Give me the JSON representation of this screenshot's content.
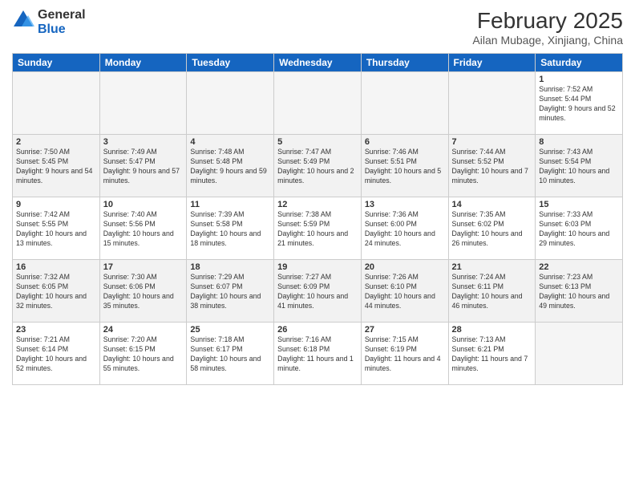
{
  "logo": {
    "line1": "General",
    "line2": "Blue"
  },
  "title": "February 2025",
  "subtitle": "Ailan Mubage, Xinjiang, China",
  "days_of_week": [
    "Sunday",
    "Monday",
    "Tuesday",
    "Wednesday",
    "Thursday",
    "Friday",
    "Saturday"
  ],
  "weeks": [
    [
      {
        "day": "",
        "info": ""
      },
      {
        "day": "",
        "info": ""
      },
      {
        "day": "",
        "info": ""
      },
      {
        "day": "",
        "info": ""
      },
      {
        "day": "",
        "info": ""
      },
      {
        "day": "",
        "info": ""
      },
      {
        "day": "1",
        "info": "Sunrise: 7:52 AM\nSunset: 5:44 PM\nDaylight: 9 hours and 52 minutes."
      }
    ],
    [
      {
        "day": "2",
        "info": "Sunrise: 7:50 AM\nSunset: 5:45 PM\nDaylight: 9 hours and 54 minutes."
      },
      {
        "day": "3",
        "info": "Sunrise: 7:49 AM\nSunset: 5:47 PM\nDaylight: 9 hours and 57 minutes."
      },
      {
        "day": "4",
        "info": "Sunrise: 7:48 AM\nSunset: 5:48 PM\nDaylight: 9 hours and 59 minutes."
      },
      {
        "day": "5",
        "info": "Sunrise: 7:47 AM\nSunset: 5:49 PM\nDaylight: 10 hours and 2 minutes."
      },
      {
        "day": "6",
        "info": "Sunrise: 7:46 AM\nSunset: 5:51 PM\nDaylight: 10 hours and 5 minutes."
      },
      {
        "day": "7",
        "info": "Sunrise: 7:44 AM\nSunset: 5:52 PM\nDaylight: 10 hours and 7 minutes."
      },
      {
        "day": "8",
        "info": "Sunrise: 7:43 AM\nSunset: 5:54 PM\nDaylight: 10 hours and 10 minutes."
      }
    ],
    [
      {
        "day": "9",
        "info": "Sunrise: 7:42 AM\nSunset: 5:55 PM\nDaylight: 10 hours and 13 minutes."
      },
      {
        "day": "10",
        "info": "Sunrise: 7:40 AM\nSunset: 5:56 PM\nDaylight: 10 hours and 15 minutes."
      },
      {
        "day": "11",
        "info": "Sunrise: 7:39 AM\nSunset: 5:58 PM\nDaylight: 10 hours and 18 minutes."
      },
      {
        "day": "12",
        "info": "Sunrise: 7:38 AM\nSunset: 5:59 PM\nDaylight: 10 hours and 21 minutes."
      },
      {
        "day": "13",
        "info": "Sunrise: 7:36 AM\nSunset: 6:00 PM\nDaylight: 10 hours and 24 minutes."
      },
      {
        "day": "14",
        "info": "Sunrise: 7:35 AM\nSunset: 6:02 PM\nDaylight: 10 hours and 26 minutes."
      },
      {
        "day": "15",
        "info": "Sunrise: 7:33 AM\nSunset: 6:03 PM\nDaylight: 10 hours and 29 minutes."
      }
    ],
    [
      {
        "day": "16",
        "info": "Sunrise: 7:32 AM\nSunset: 6:05 PM\nDaylight: 10 hours and 32 minutes."
      },
      {
        "day": "17",
        "info": "Sunrise: 7:30 AM\nSunset: 6:06 PM\nDaylight: 10 hours and 35 minutes."
      },
      {
        "day": "18",
        "info": "Sunrise: 7:29 AM\nSunset: 6:07 PM\nDaylight: 10 hours and 38 minutes."
      },
      {
        "day": "19",
        "info": "Sunrise: 7:27 AM\nSunset: 6:09 PM\nDaylight: 10 hours and 41 minutes."
      },
      {
        "day": "20",
        "info": "Sunrise: 7:26 AM\nSunset: 6:10 PM\nDaylight: 10 hours and 44 minutes."
      },
      {
        "day": "21",
        "info": "Sunrise: 7:24 AM\nSunset: 6:11 PM\nDaylight: 10 hours and 46 minutes."
      },
      {
        "day": "22",
        "info": "Sunrise: 7:23 AM\nSunset: 6:13 PM\nDaylight: 10 hours and 49 minutes."
      }
    ],
    [
      {
        "day": "23",
        "info": "Sunrise: 7:21 AM\nSunset: 6:14 PM\nDaylight: 10 hours and 52 minutes."
      },
      {
        "day": "24",
        "info": "Sunrise: 7:20 AM\nSunset: 6:15 PM\nDaylight: 10 hours and 55 minutes."
      },
      {
        "day": "25",
        "info": "Sunrise: 7:18 AM\nSunset: 6:17 PM\nDaylight: 10 hours and 58 minutes."
      },
      {
        "day": "26",
        "info": "Sunrise: 7:16 AM\nSunset: 6:18 PM\nDaylight: 11 hours and 1 minute."
      },
      {
        "day": "27",
        "info": "Sunrise: 7:15 AM\nSunset: 6:19 PM\nDaylight: 11 hours and 4 minutes."
      },
      {
        "day": "28",
        "info": "Sunrise: 7:13 AM\nSunset: 6:21 PM\nDaylight: 11 hours and 7 minutes."
      },
      {
        "day": "",
        "info": ""
      }
    ]
  ]
}
